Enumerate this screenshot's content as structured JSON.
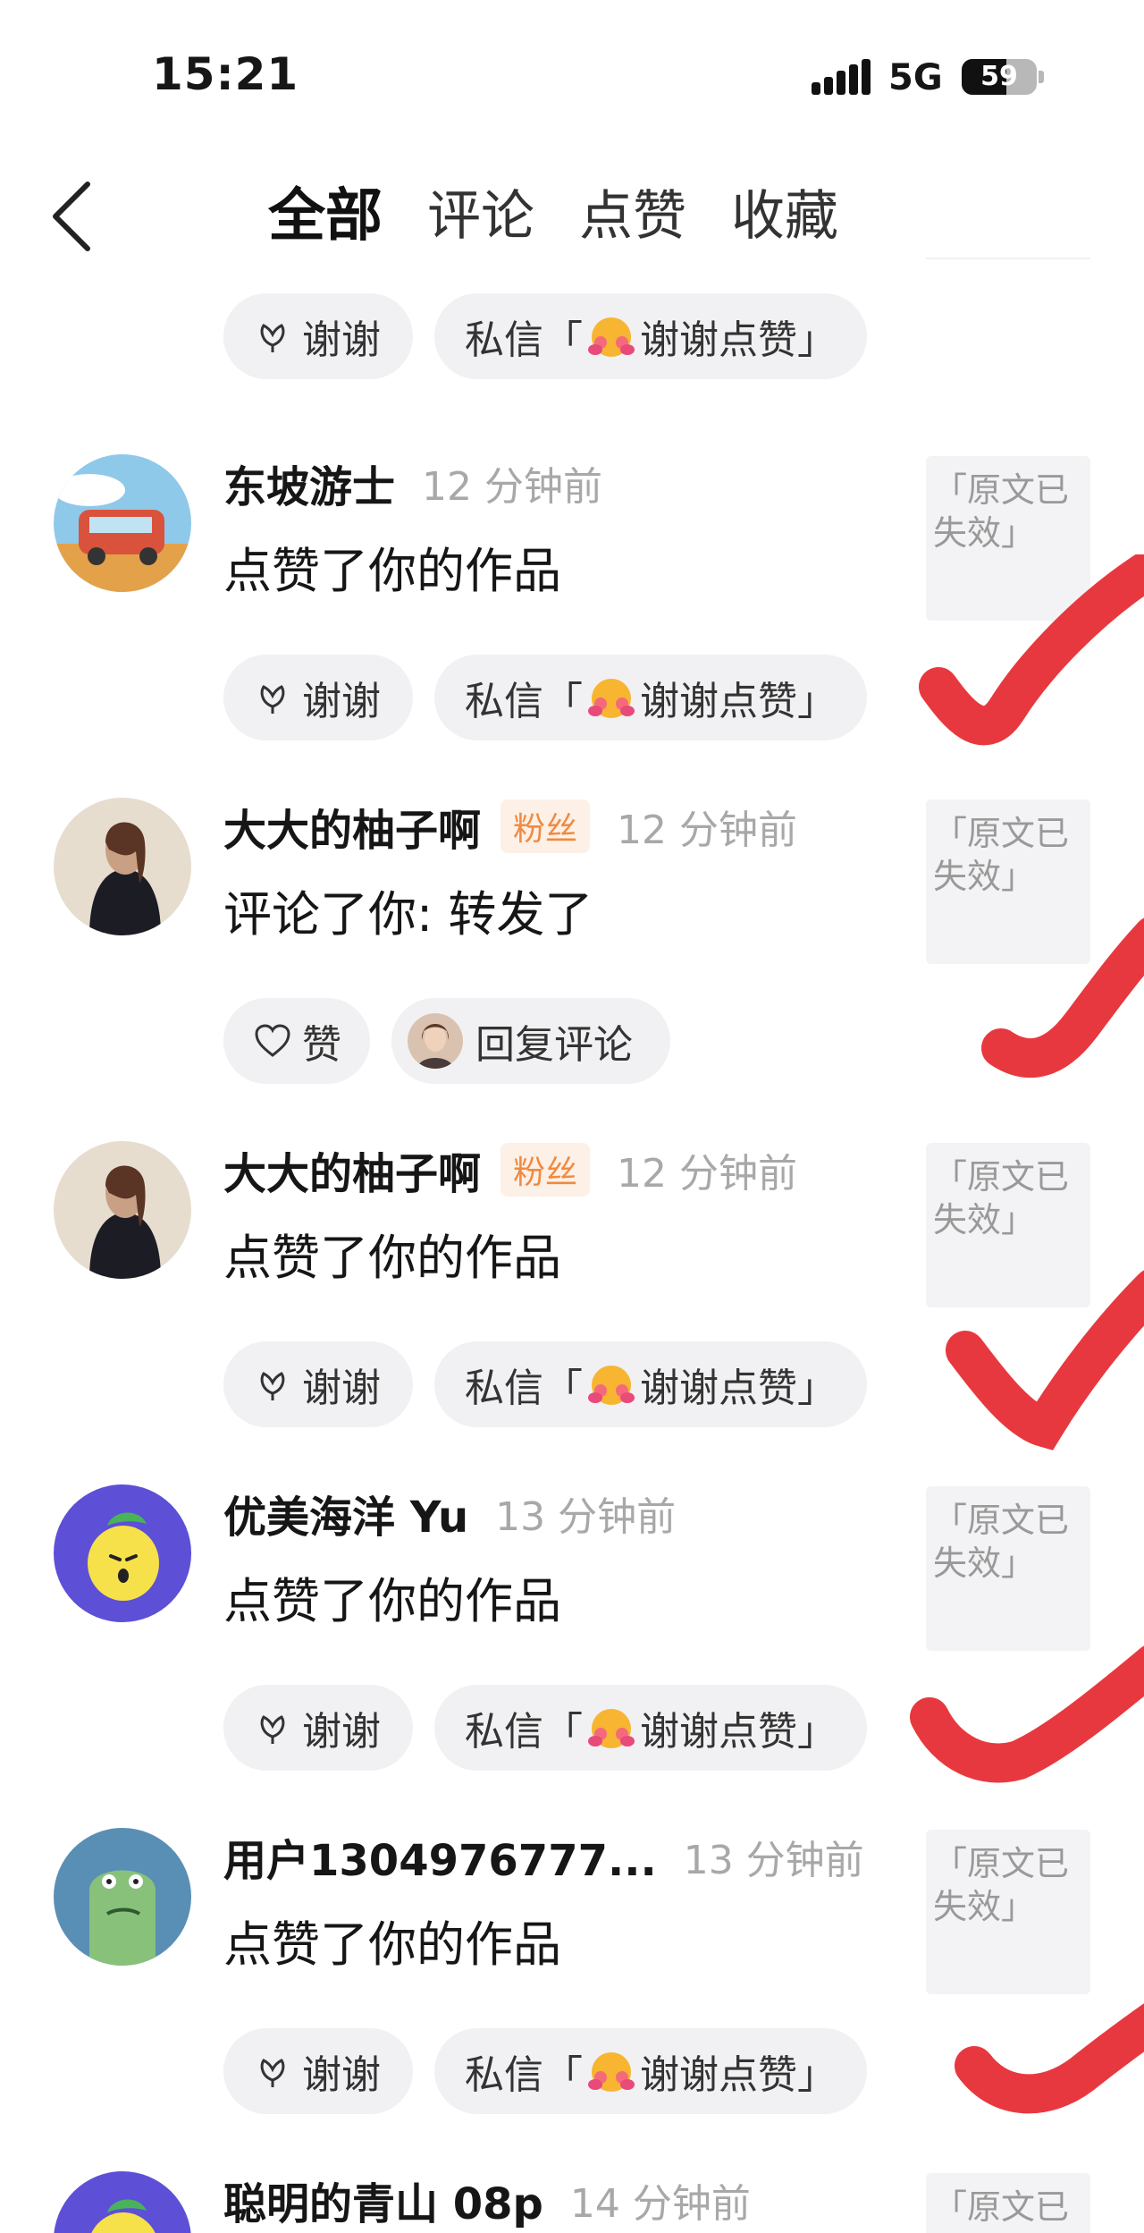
{
  "status": {
    "time": "15:21",
    "network": "5G",
    "battery": "59",
    "battery_level": 0.59
  },
  "header": {
    "tabs": [
      "全部",
      "评论",
      "点赞",
      "收藏"
    ],
    "active_tab": "全部"
  },
  "top_pills": {
    "thanks": "谢谢",
    "dm_prefix": "私信「",
    "dm_suffix": "谢谢点赞」"
  },
  "rows": [
    {
      "name": "东坡游士",
      "badge": "",
      "time": "12 分钟前",
      "action": "点赞了你的作品",
      "btn1": "谢谢",
      "btn2_prefix": "私信「",
      "btn2_suffix": "谢谢点赞」",
      "thumb": "「原文已失效」"
    },
    {
      "name": "大大的柚子啊",
      "badge": "粉丝",
      "time": "12 分钟前",
      "action": "评论了你: 转发了",
      "btn1": "赞",
      "btn2": "回复评论",
      "thumb": "「原文已失效」"
    },
    {
      "name": "大大的柚子啊",
      "badge": "粉丝",
      "time": "12 分钟前",
      "action": "点赞了你的作品",
      "btn1": "谢谢",
      "btn2_prefix": "私信「",
      "btn2_suffix": "谢谢点赞」",
      "thumb": "「原文已失效」"
    },
    {
      "name": "优美海洋 Yu",
      "badge": "",
      "time": "13 分钟前",
      "action": "点赞了你的作品",
      "btn1": "谢谢",
      "btn2_prefix": "私信「",
      "btn2_suffix": "谢谢点赞」",
      "thumb": "「原文已失效」"
    },
    {
      "name": "用户1304976777...",
      "badge": "",
      "time": "13 分钟前",
      "action": "点赞了你的作品",
      "btn1": "谢谢",
      "btn2_prefix": "私信「",
      "btn2_suffix": "谢谢点赞」",
      "thumb": "「原文已失效」"
    },
    {
      "name": "聪明的青山 08p",
      "badge": "",
      "time": "14 分钟前",
      "action": "",
      "thumb": "「原文已"
    }
  ],
  "colors": {
    "check_mark": "#e8383f",
    "badge_text": "#f08a40",
    "pill_bg": "#f1f1f3"
  }
}
